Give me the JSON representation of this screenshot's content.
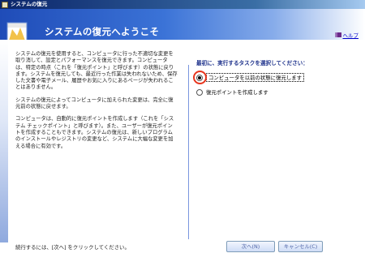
{
  "window": {
    "title": "システムの復元"
  },
  "header": {
    "title": "システムの復元へようこそ",
    "help_label": "ヘルプ"
  },
  "description": {
    "paragraphs": [
      "システムの復元を使用すると、コンピュータに行った不適切な変更を取り消して、設定とパフォーマンスを復元できます。コンピュータは、特定の時点（これを「復元ポイント」と呼びます）の状態に戻ります。システムを復元しても、最近行った作業は失われないため、保存した文書や電子メール、履歴やお気に入りにあるページが失われることはありません。",
      "システムの復元によってコンピュータに加えられた変更は、完全に復元前の状態に戻せます。",
      "コンピュータは、自動的に復元ポイントを作成します（これを「システム チェックポイント」と呼びます）。また、ユーザーが復元ポイントを作成することもできます。システムの復元は、新しいプログラムのインストールやレジストリの変更など、システムに大幅な変更を加える場合に有効です。"
    ]
  },
  "task_selection": {
    "prompt": "最初に、実行するタスクを選択してください：",
    "options": [
      {
        "label": "コンピュータを以前の状態に復元します",
        "selected": true
      },
      {
        "label": "復元ポイントを作成します",
        "selected": false
      }
    ]
  },
  "footer": {
    "instruction": "続行するには、[次へ] をクリックしてください。"
  },
  "buttons": {
    "next_label": "次へ(N)",
    "cancel_label": "キャンセル(C)"
  },
  "colors": {
    "header_blue": "#1f4cb8",
    "prompt_text": "#1b2f8a",
    "highlight_ring": "#e8351d",
    "divider": "#7a96df"
  }
}
